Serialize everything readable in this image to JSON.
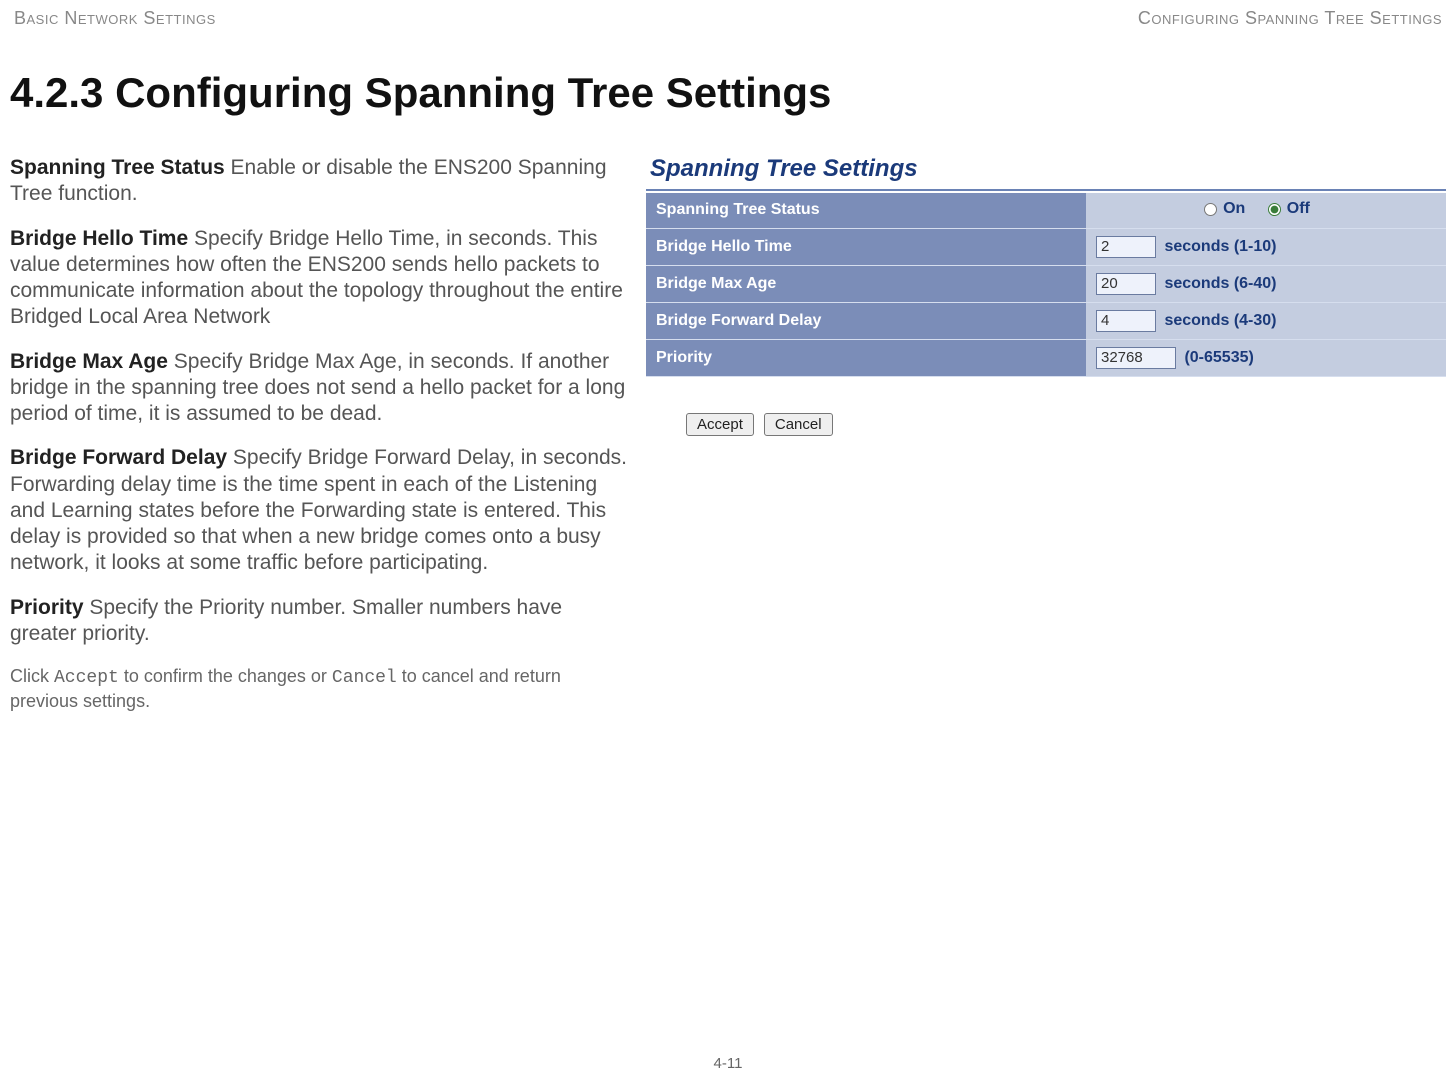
{
  "header": {
    "left": "Basic Network Settings",
    "right": "Configuring Spanning Tree Settings"
  },
  "section_title": "4.2.3 Configuring Spanning Tree Settings",
  "definitions": {
    "status": {
      "term": "Spanning Tree Status",
      "desc": "  Enable or disable the ENS200 Spanning Tree function."
    },
    "hello": {
      "term": "Bridge Hello Time",
      "desc": "  Specify Bridge Hello Time, in seconds. This value determines how often the ENS200 sends hello packets to communicate information about the topology throughout the entire Bridged Local Area Network"
    },
    "maxage": {
      "term": "Bridge Max Age",
      "desc": "  Specify Bridge Max Age, in seconds. If another bridge in the spanning tree does not send a hello packet for a long period of time, it is assumed to be dead."
    },
    "fwd": {
      "term": "Bridge Forward Delay",
      "desc": "  Specify Bridge Forward Delay, in seconds. Forwarding delay time is the time spent in each of the Listening and Learning states before the Forwarding state is entered. This delay is provided so that when a new bridge comes onto a busy network, it looks at some traffic before participating."
    },
    "priority": {
      "term": "Priority",
      "desc": "  Specify the Priority number. Smaller numbers have greater priority."
    }
  },
  "footer_note": {
    "pre": "Click ",
    "accept": "Accept",
    "mid": " to confirm the changes or ",
    "cancel": "Cancel",
    "post": " to cancel and return previous settings."
  },
  "panel": {
    "title": "Spanning Tree Settings",
    "rows": {
      "status": {
        "label": "Spanning Tree Status",
        "on_label": "On",
        "off_label": "Off",
        "selected": "off"
      },
      "hello": {
        "label": "Bridge Hello Time",
        "value": "2",
        "unit": "seconds (1-10)"
      },
      "maxage": {
        "label": "Bridge Max Age",
        "value": "20",
        "unit": "seconds (6-40)"
      },
      "fwd": {
        "label": "Bridge Forward Delay",
        "value": "4",
        "unit": "seconds (4-30)"
      },
      "priority": {
        "label": "Priority",
        "value": "32768",
        "unit": "(0-65535)"
      }
    },
    "buttons": {
      "accept": "Accept",
      "cancel": "Cancel"
    }
  },
  "page_number": "4-11"
}
